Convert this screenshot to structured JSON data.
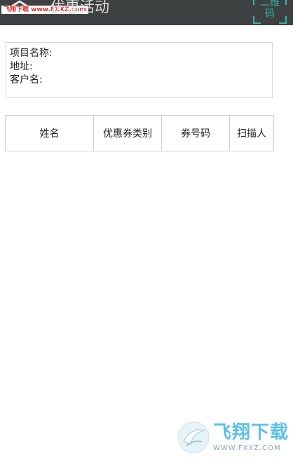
{
  "header": {
    "title": "优惠活动",
    "back_icon": "back-arrow-icon",
    "watermark_top": "飞翔下载 www.FXXZ.com",
    "qr_button": {
      "line1": "二维",
      "line2": "码",
      "icon": "scan-frame-icon",
      "color": "#2fb3a8"
    },
    "background": "#3e4142"
  },
  "info": {
    "project_label": "项目名称:",
    "address_label": "地址:",
    "customer_label": "客户名:"
  },
  "table": {
    "columns": [
      "姓名",
      "优惠券类别",
      "券号码",
      "扫描人"
    ]
  },
  "watermark_bottom": {
    "brand": "飞翔下载",
    "url": "WWW.FXXZ.COM",
    "brand_color": "#5bc0ea"
  }
}
